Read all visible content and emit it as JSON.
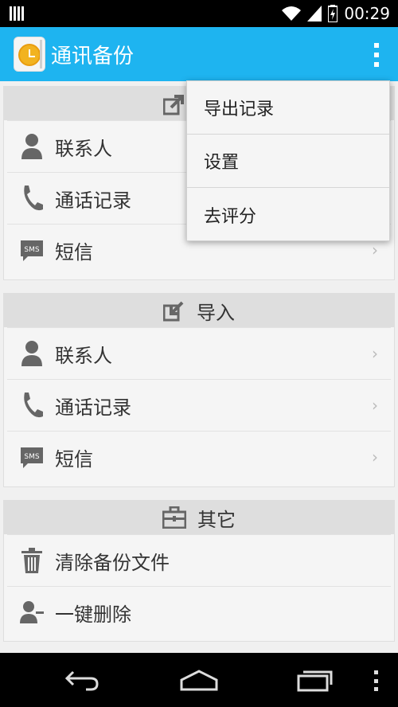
{
  "status": {
    "time": "00:29"
  },
  "app": {
    "title": "通讯备份"
  },
  "menu": {
    "items": [
      "导出记录",
      "设置",
      "去评分"
    ]
  },
  "export_section": {
    "rows": [
      {
        "label": "联系人",
        "icon": "person-icon"
      },
      {
        "label": "通话记录",
        "icon": "phone-icon"
      },
      {
        "label": "短信",
        "icon": "sms-icon"
      }
    ]
  },
  "import_section": {
    "title": "导入",
    "rows": [
      {
        "label": "联系人",
        "icon": "person-icon"
      },
      {
        "label": "通话记录",
        "icon": "phone-icon"
      },
      {
        "label": "短信",
        "icon": "sms-icon"
      }
    ]
  },
  "other_section": {
    "title": "其它",
    "rows": [
      {
        "label": "清除备份文件",
        "icon": "trash-icon"
      },
      {
        "label": "一键删除",
        "icon": "remove-contact-icon"
      }
    ]
  },
  "sms_badge": "SMS",
  "colors": {
    "action_bar": "#1eb4f0",
    "header_bg": "#dedede",
    "card_bg": "#f5f5f5"
  }
}
